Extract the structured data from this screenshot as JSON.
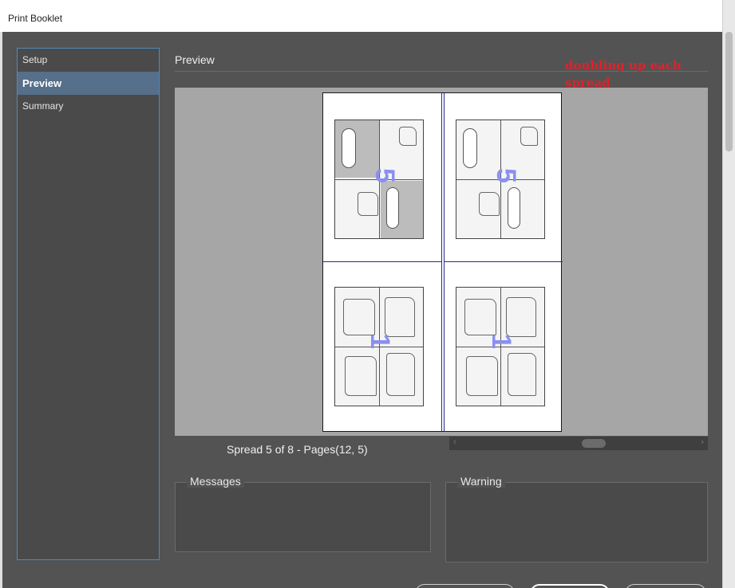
{
  "window": {
    "title": "Print Booklet"
  },
  "sidebar": {
    "items": [
      {
        "label": "Setup",
        "active": false
      },
      {
        "label": "Preview",
        "active": true
      },
      {
        "label": "Summary",
        "active": false
      }
    ]
  },
  "preview": {
    "section_title": "Preview",
    "spread_caption": "Spread 5 of 8 - Pages(12, 5)"
  },
  "annotation": {
    "text": "doubling up each spread",
    "color": "#e3202a"
  },
  "panels": {
    "messages_label": "Messages",
    "warning_label": "Warning"
  },
  "colors": {
    "accent": "#4f8ab8",
    "active_nav": "#566f8a",
    "background": "#535353"
  }
}
